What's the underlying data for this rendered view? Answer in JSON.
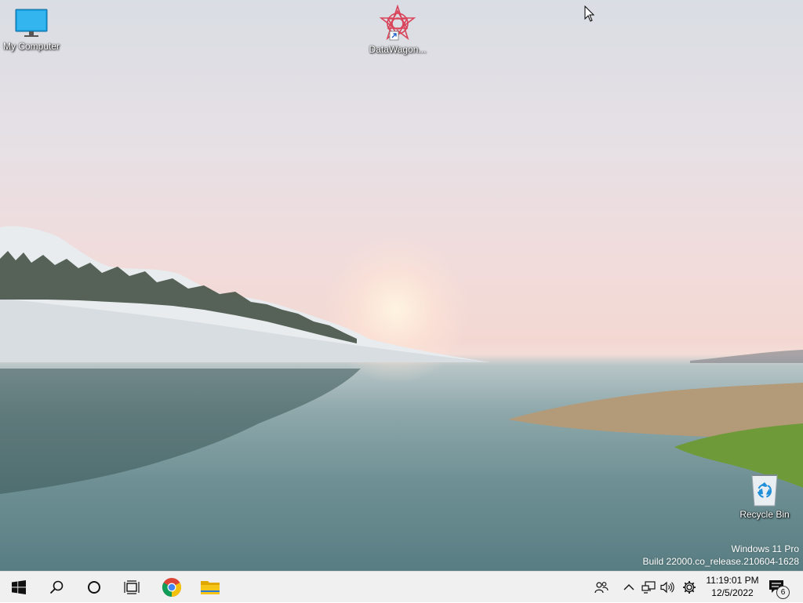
{
  "desktop": {
    "icons": [
      {
        "label": "My Computer",
        "icon": "monitor-icon"
      },
      {
        "label": "DataWagon...",
        "icon": "datawagon-shortcut-icon"
      },
      {
        "label": "Recycle Bin",
        "icon": "recycle-bin-icon"
      }
    ],
    "watermark": {
      "line1": "Windows 11 Pro",
      "line2": "Build 22000.co_release.210604-1628"
    }
  },
  "taskbar": {
    "buttons": [
      {
        "icon": "windows-start-icon"
      },
      {
        "icon": "search-icon"
      },
      {
        "icon": "cortana-icon"
      },
      {
        "icon": "task-view-icon"
      },
      {
        "icon": "chrome-icon"
      },
      {
        "icon": "file-explorer-icon"
      }
    ],
    "tray": {
      "icons": [
        "people-icon",
        "chevron-up-icon",
        "network-icon",
        "volume-icon",
        "settings-gear-icon"
      ],
      "time": "11:19:01 PM",
      "date": "12/5/2022",
      "notification_count": "6"
    }
  },
  "colors": {
    "taskbar_bg": "#f0f0f0",
    "accent_folder": "#f5c518"
  }
}
